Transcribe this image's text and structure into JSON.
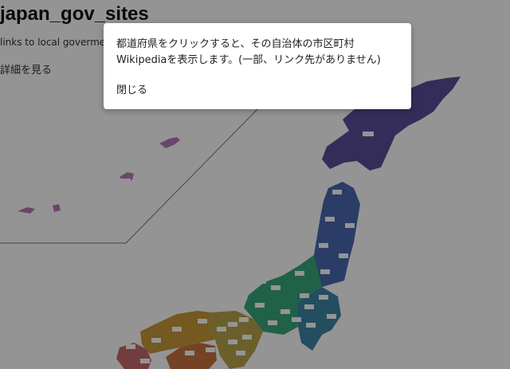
{
  "page": {
    "title": "japan_gov_sites",
    "subtitle": "links to local govermen",
    "details_link": "詳細を見る"
  },
  "dialog": {
    "message": "都道府県をクリックすると、その自治体の市区町村Wikipediaを表示します。(一部、リンク先がありません)",
    "close_label": "閉じる"
  },
  "map": {
    "regions": [
      {
        "name": "hokkaido",
        "color": "#5b4f9a"
      },
      {
        "name": "tohoku",
        "color": "#4a6ab0"
      },
      {
        "name": "kanto",
        "color": "#3f86a6"
      },
      {
        "name": "chubu",
        "color": "#3aa87a"
      },
      {
        "name": "kinki",
        "color": "#b9a44a"
      },
      {
        "name": "chugoku",
        "color": "#c99a3a"
      },
      {
        "name": "shikoku",
        "color": "#c8723e"
      },
      {
        "name": "kyushu",
        "color": "#c76a6a"
      },
      {
        "name": "okinawa",
        "color": "#b67ab9"
      }
    ]
  }
}
